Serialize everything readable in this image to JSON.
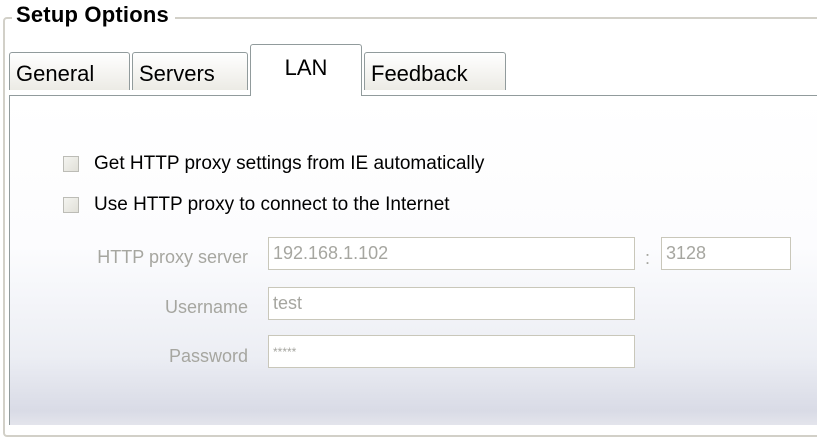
{
  "group": {
    "title": "Setup Options"
  },
  "tabs": [
    {
      "label": "General",
      "active": false
    },
    {
      "label": "Servers",
      "active": false
    },
    {
      "label": "LAN",
      "active": true
    },
    {
      "label": "Feedback",
      "active": false
    }
  ],
  "lan": {
    "auto_ie": {
      "label": "Get HTTP proxy settings from IE automatically",
      "checked": false
    },
    "use_proxy": {
      "label": "Use HTTP proxy to connect to the Internet",
      "checked": false
    },
    "proxy_server": {
      "label": "HTTP proxy server",
      "value": "192.168.1.102"
    },
    "port_separator": ":",
    "port": {
      "value": "3128"
    },
    "username": {
      "label": "Username",
      "value": "test"
    },
    "password": {
      "label": "Password",
      "value": "*****"
    }
  },
  "colors": {
    "disabled_text": "#a6a6a0",
    "border": "#919b9c",
    "field_border": "#c9c7ba"
  }
}
